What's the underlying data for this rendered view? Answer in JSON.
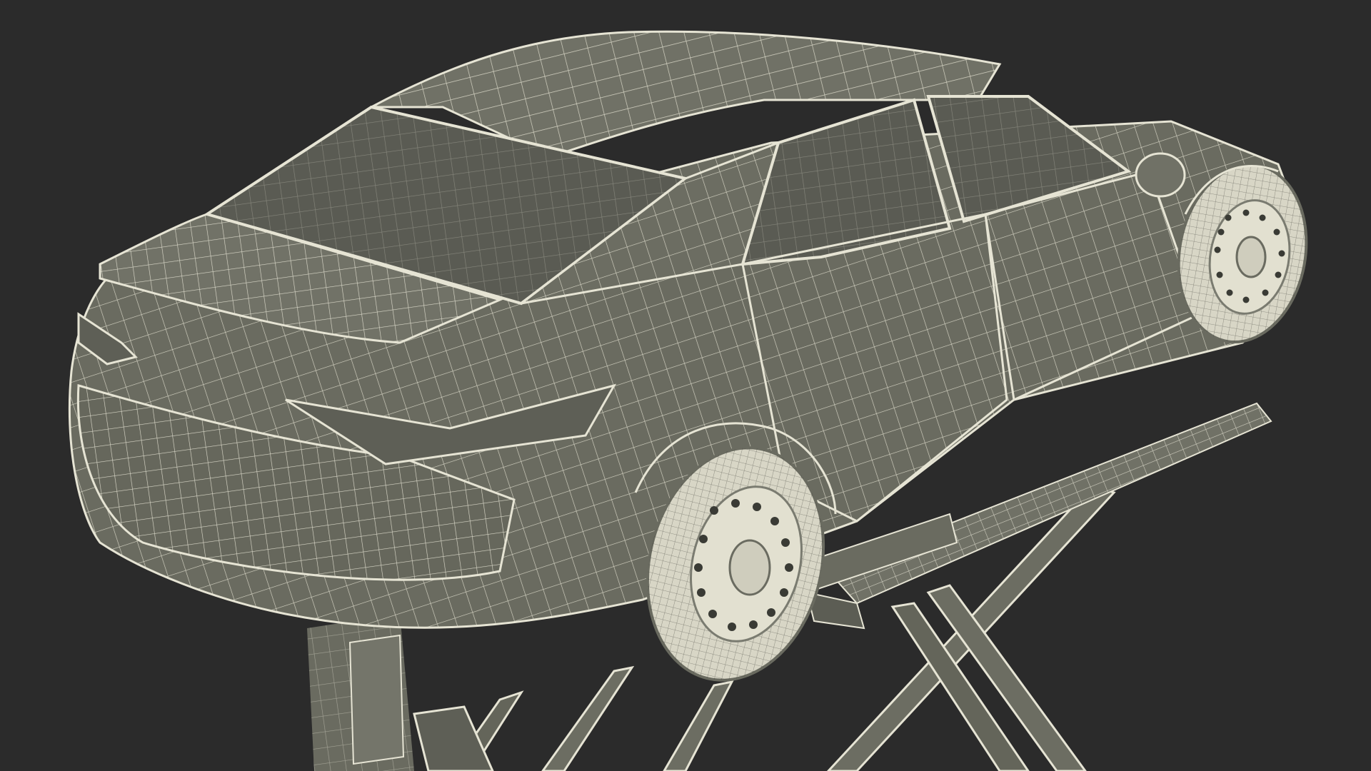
{
  "scene": {
    "subject": "car-on-scissor-lift-wireframe",
    "colors": {
      "background": "#2b2b2b",
      "surface": "#6a6b60",
      "surface_dark": "#55564d",
      "surface_light": "#7c7d71",
      "glass": "#5a5b53",
      "wire": "#e6e4d4",
      "wheel": "#d8d6c6"
    }
  }
}
